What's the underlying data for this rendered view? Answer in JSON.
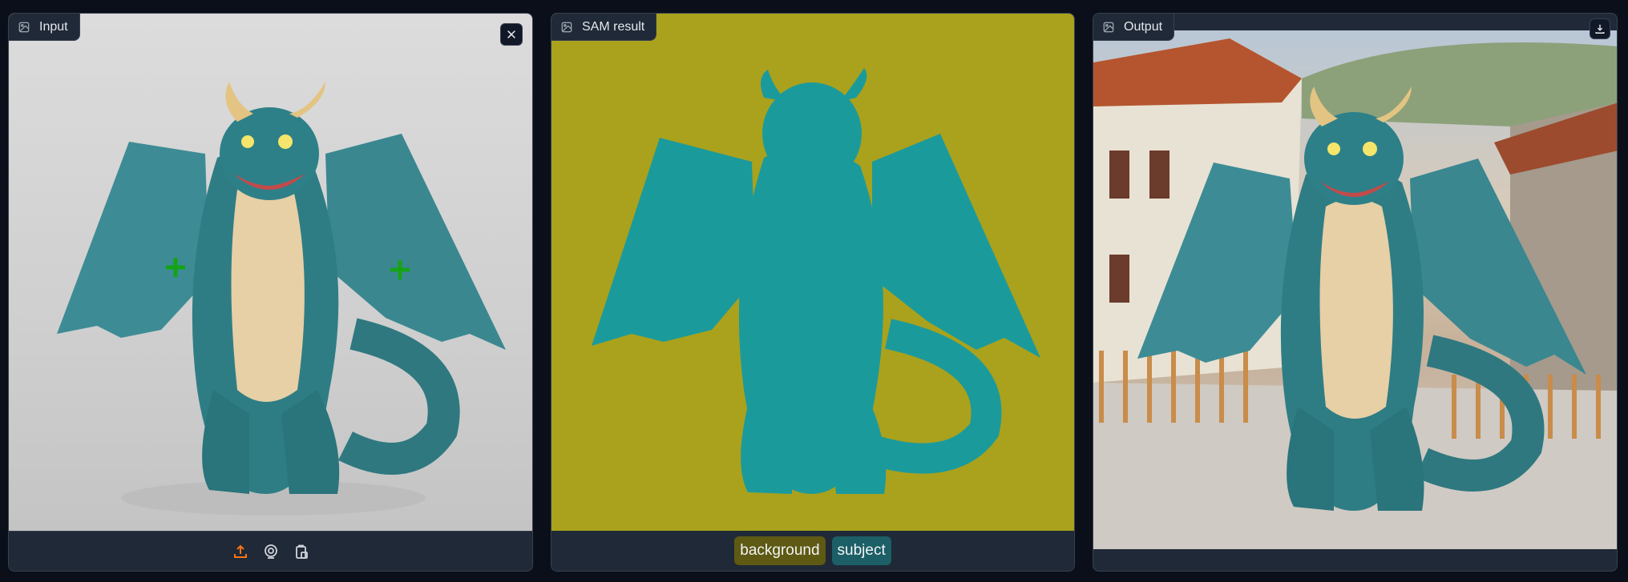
{
  "panels": {
    "input": {
      "label": "Input",
      "label_icon": "image-icon",
      "close_icon": "close-icon"
    },
    "sam": {
      "label": "SAM result",
      "label_icon": "image-icon"
    },
    "output": {
      "label": "Output",
      "label_icon": "image-icon",
      "download_icon": "download-icon"
    }
  },
  "input_toolbar": {
    "upload_icon": "upload-icon",
    "webcam_icon": "webcam-icon",
    "clipboard_icon": "clipboard-icon"
  },
  "legend": [
    {
      "label": "background",
      "color": "#5e5a14"
    },
    {
      "label": "subject",
      "color": "#1c5f66"
    }
  ],
  "colors": {
    "accent": "#f97316",
    "dragon": "#2e7f86",
    "mask_background": "#aaa21c",
    "point_marker": "#15a316"
  }
}
